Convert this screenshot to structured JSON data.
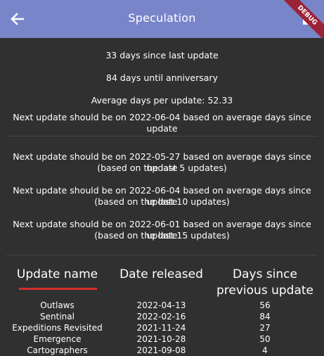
{
  "appbar": {
    "title": "Speculation",
    "back_icon": "arrow-back-icon",
    "action_icon": "export-icon",
    "debug_label": "DEBUG",
    "color": "#7985c9"
  },
  "stats": {
    "since_last": "33 days since last update",
    "until_anniversary": "84 days until anniversary",
    "average": "Average days per update: 52.33",
    "prediction_all": "Next update should be on 2022-06-04 based on average days since update"
  },
  "predictions": [
    {
      "line1": "Next update should be on 2022-05-27 based on average days since update",
      "line2": "(based on the last 5 updates)"
    },
    {
      "line1": "Next update should be on 2022-06-04 based on average days since update",
      "line2": "(based on the last 10 updates)"
    },
    {
      "line1": "Next update should be on 2022-06-01 based on average days since update",
      "line2": "(based on the last 15 updates)"
    }
  ],
  "table": {
    "headers": {
      "name": "Update name",
      "date": "Date released",
      "days_line1": "Days since",
      "days_line2": "previous update"
    },
    "sorted_column_color": "#d32f2f",
    "rows": [
      {
        "name": "Outlaws",
        "date": "2022-04-13",
        "days": "56"
      },
      {
        "name": "Sentinal",
        "date": "2022-02-16",
        "days": "84"
      },
      {
        "name": "Expeditions Revisited",
        "date": "2021-11-24",
        "days": "27"
      },
      {
        "name": "Emergence",
        "date": "2021-10-28",
        "days": "50"
      },
      {
        "name": "Cartographers",
        "date": "2021-09-08",
        "days": "4"
      }
    ]
  }
}
